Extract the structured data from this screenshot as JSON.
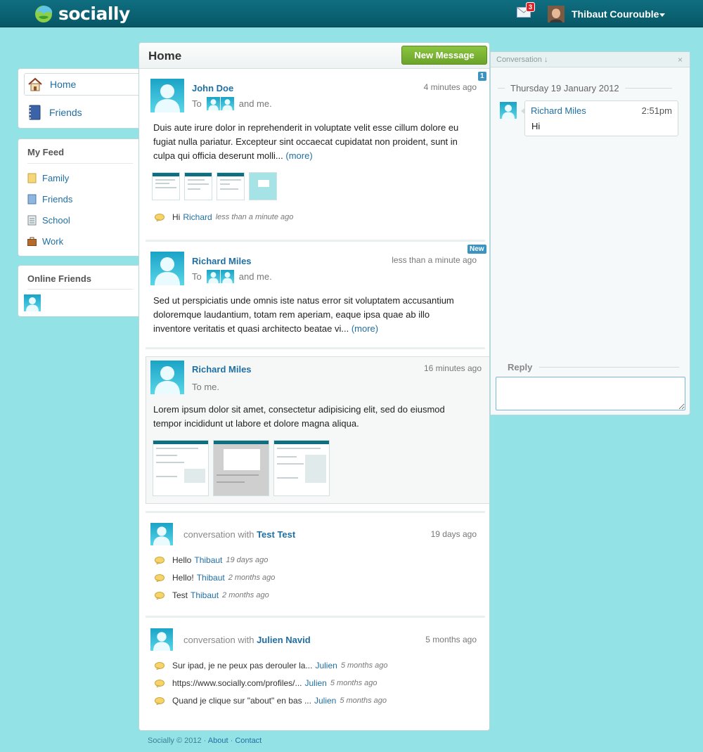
{
  "topbar": {
    "brand": "socially",
    "mail_count": "3",
    "user_name": "Thibaut Courouble"
  },
  "sidebar": {
    "nav": [
      {
        "label": "Home",
        "icon": "home-icon"
      },
      {
        "label": "Friends",
        "icon": "address-book-icon"
      }
    ],
    "feed_title": "My Feed",
    "feeds": [
      {
        "label": "Family",
        "icon": "folder-icon"
      },
      {
        "label": "Friends",
        "icon": "notebook-icon"
      },
      {
        "label": "School",
        "icon": "notepad-icon"
      },
      {
        "label": "Work",
        "icon": "briefcase-icon"
      }
    ],
    "online_title": "Online Friends"
  },
  "main": {
    "title": "Home",
    "new_message": "New Message",
    "posts": [
      {
        "name": "John Doe",
        "time": "4 minutes ago",
        "badge": "1",
        "to_prefix": "To",
        "to_suffix": "and me.",
        "body": "Duis aute irure dolor in reprehenderit in voluptate velit esse cillum dolore eu fugiat nulla pariatur. Excepteur sint occaecat cupidatat non proident, sunt in culpa qui officia deserunt molli...",
        "more": "(more)",
        "comment": {
          "text": "Hi",
          "who": "Richard",
          "ago": "less than a minute ago"
        }
      },
      {
        "name": "Richard Miles",
        "time": "less than a minute ago",
        "badge": "New",
        "to_prefix": "To",
        "to_suffix": "and me.",
        "body": "Sed ut perspiciatis unde omnis iste natus error sit voluptatem accusantium doloremque laudantium, totam rem aperiam, eaque ipsa quae ab illo inventore veritatis et quasi architecto beatae vi...",
        "more": "(more)"
      },
      {
        "name": "Richard Miles",
        "time": "16 minutes ago",
        "to": "To me.",
        "body": "Lorem ipsum dolor sit amet, consectetur adipisicing elit, sed do eiusmod tempor incididunt ut labore et dolore magna aliqua."
      }
    ],
    "conversations": [
      {
        "prefix": "conversation with",
        "name": "Test Test",
        "time": "19 days ago",
        "comments": [
          {
            "text": "Hello",
            "who": "Thibaut",
            "ago": "19 days ago"
          },
          {
            "text": "Hello!",
            "who": "Thibaut",
            "ago": "2 months ago"
          },
          {
            "text": "Test",
            "who": "Thibaut",
            "ago": "2 months ago"
          }
        ]
      },
      {
        "prefix": "conversation with",
        "name": "Julien Navid",
        "time": "5 months ago",
        "comments": [
          {
            "text": "Sur ipad, je ne peux pas derouler la...",
            "who": "Julien",
            "ago": "5 months ago"
          },
          {
            "text": "https://www.socially.com/profiles/...",
            "who": "Julien",
            "ago": "5 months ago"
          },
          {
            "text": "Quand je clique sur \"about\" en bas ...",
            "who": "Julien",
            "ago": "5 months ago"
          }
        ]
      }
    ]
  },
  "conversation": {
    "title": "Conversation ↓",
    "close": "×",
    "date": "Thursday 19 January 2012",
    "message": {
      "name": "Richard Miles",
      "time": "2:51pm",
      "text": "Hi"
    },
    "reply_label": "Reply"
  },
  "footer": {
    "copyright": "Socially © 2012",
    "sep": "·",
    "about": "About",
    "contact": "Contact"
  },
  "colors": {
    "background": "#93e3e6",
    "topbar": "#0f6e80",
    "link": "#1f6fa3",
    "new_message": "#7ab533",
    "badge": "#3c93c0",
    "mail_badge": "#d9262b"
  }
}
